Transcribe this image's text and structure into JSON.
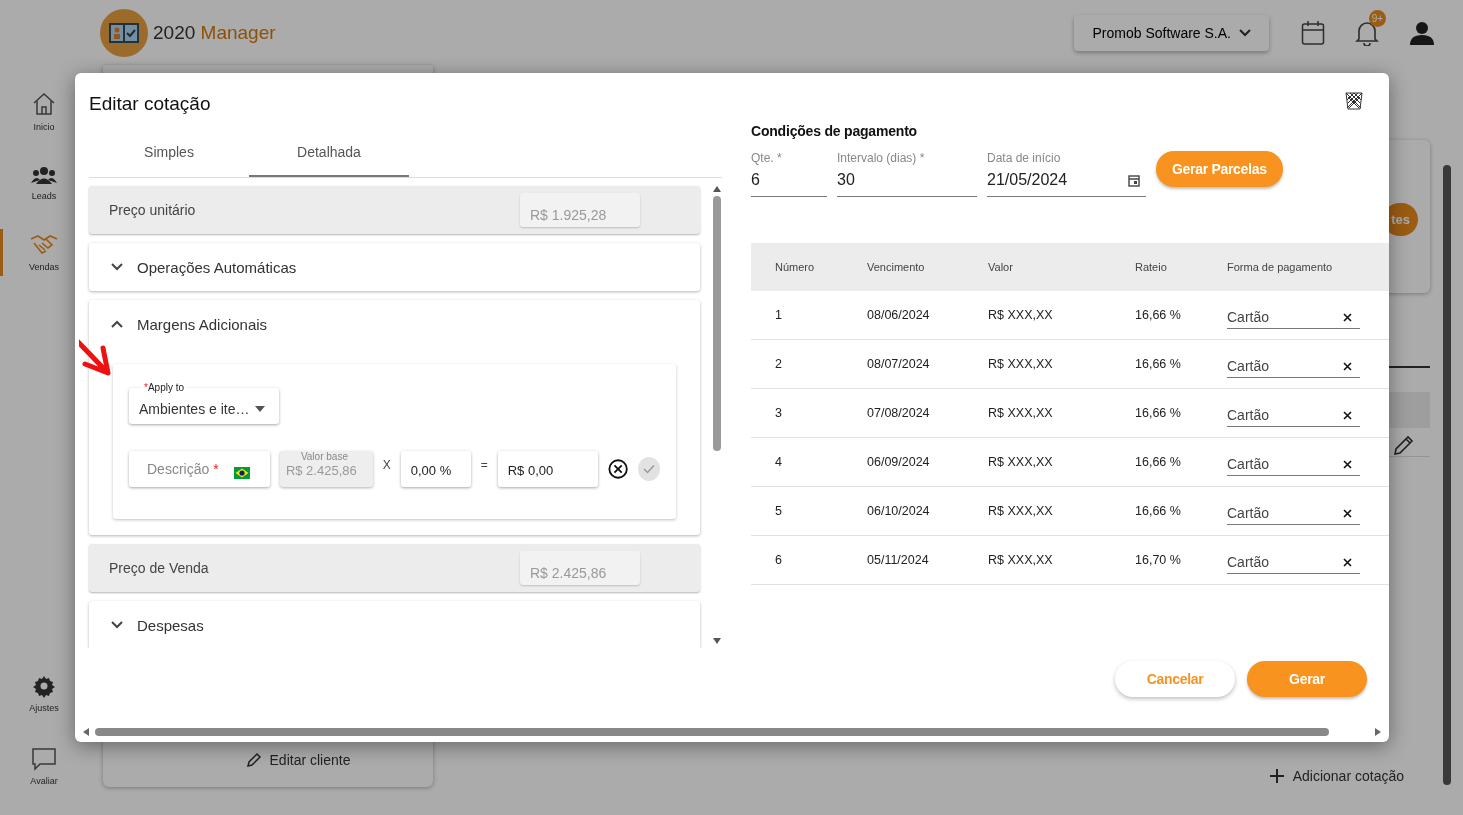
{
  "header": {
    "brand": {
      "number": "2020",
      "name": "Manager"
    },
    "company": "Promob Software S.A.",
    "notification_badge": "9+"
  },
  "sidebar": {
    "items": [
      {
        "kind": "home",
        "label": "Inicio",
        "selected": false
      },
      {
        "kind": "people",
        "label": "Leads",
        "selected": false
      },
      {
        "kind": "handshake",
        "label": "Vendas",
        "selected": true
      }
    ],
    "bottom_items": [
      {
        "kind": "gear",
        "label": "Ajustes",
        "selected": false
      },
      {
        "kind": "chat",
        "label": "Avaliar",
        "selected": false
      }
    ]
  },
  "background": {
    "partial_button": "tes",
    "edit_client": "Editar cliente",
    "add_quote": "Adicionar cotação"
  },
  "modal": {
    "title": "Editar cotação",
    "tabs": [
      {
        "label": "Simples",
        "selected": false
      },
      {
        "label": "Detalhada",
        "selected": true
      }
    ],
    "sections": [
      {
        "kind": "price",
        "label": "Preço unitário",
        "value": "R$ 1.925,28"
      },
      {
        "kind": "accordion",
        "label": "Operações Automáticas",
        "expanded": false
      },
      {
        "kind": "accordion",
        "label": "Margens Adicionais",
        "expanded": true,
        "form": {
          "apply_to": {
            "required_mark": "*",
            "label": "Apply to",
            "value": "Ambientes e ite…"
          },
          "description": {
            "placeholder": "Descrição",
            "required_mark": "*"
          },
          "base_value": {
            "label": "Valor base",
            "value": "R$ 2.425,86"
          },
          "multiply": "X",
          "percent": "0,00 %",
          "equals": "=",
          "result": "R$ 0,00",
          "confirm_disabled": true
        }
      },
      {
        "kind": "price",
        "label": "Preço de Venda",
        "value": "R$ 2.425,86"
      },
      {
        "kind": "accordion",
        "label": "Despesas",
        "expanded": false
      }
    ],
    "payment": {
      "title": "Condições de pagamento",
      "quantity": {
        "label": "Qte. *",
        "value": "6"
      },
      "interval": {
        "label": "Intervalo (dias) *",
        "value": "30"
      },
      "start_date": {
        "label": "Data de início",
        "value": "21/05/2024"
      },
      "generate_installments": "Gerar Parcelas",
      "columns": [
        "Número",
        "Vencimento",
        "Valor",
        "Rateio",
        "Forma de pagamento"
      ],
      "rows": [
        {
          "number": "1",
          "due": "08/06/2024",
          "value": "R$ XXX,XX",
          "share": "16,66 %",
          "method": "Cartão"
        },
        {
          "number": "2",
          "due": "08/07/2024",
          "value": "R$ XXX,XX",
          "share": "16,66 %",
          "method": "Cartão"
        },
        {
          "number": "3",
          "due": "07/08/2024",
          "value": "R$ XXX,XX",
          "share": "16,66 %",
          "method": "Cartão"
        },
        {
          "number": "4",
          "due": "06/09/2024",
          "value": "R$ XXX,XX",
          "share": "16,66 %",
          "method": "Cartão"
        },
        {
          "number": "5",
          "due": "06/10/2024",
          "value": "R$ XXX,XX",
          "share": "16,66 %",
          "method": "Cartão"
        },
        {
          "number": "6",
          "due": "05/11/2024",
          "value": "R$ XXX,XX",
          "share": "16,70 %",
          "method": "Cartão"
        }
      ]
    },
    "buttons": {
      "cancel": "Cancelar",
      "generate": "Gerar"
    }
  }
}
